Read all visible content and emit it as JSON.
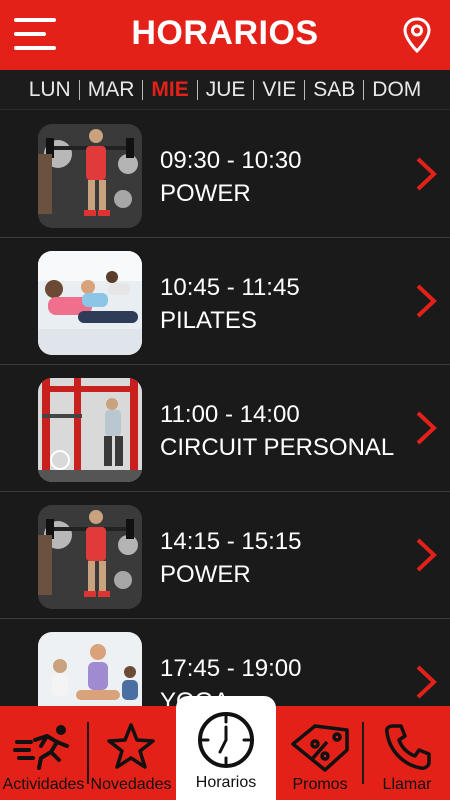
{
  "header": {
    "title": "HORARIOS",
    "menu_icon": "hamburger-menu-icon",
    "location_icon": "map-pin-icon"
  },
  "days": {
    "items": [
      "LUN",
      "MAR",
      "MIE",
      "JUE",
      "VIE",
      "SAB",
      "DOM"
    ],
    "selected": "MIE"
  },
  "schedule": [
    {
      "time": "09:30 - 10:30",
      "class": "POWER",
      "thumb": "power"
    },
    {
      "time": "10:45 - 11:45",
      "class": "PILATES",
      "thumb": "pilates"
    },
    {
      "time": "11:00 - 14:00",
      "class": "CIRCUIT PERSONAL",
      "thumb": "circuit"
    },
    {
      "time": "14:15 - 15:15",
      "class": "POWER",
      "thumb": "power"
    },
    {
      "time": "17:45 - 19:00",
      "class": "YOGA",
      "thumb": "yoga"
    }
  ],
  "tabbar": {
    "items": [
      {
        "label": "Actividades",
        "icon": "runner-icon"
      },
      {
        "label": "Novedades",
        "icon": "star-icon"
      },
      {
        "label": "Horarios",
        "icon": "clock-icon"
      },
      {
        "label": "Promos",
        "icon": "percent-tag-icon"
      },
      {
        "label": "Llamar",
        "icon": "phone-icon"
      }
    ],
    "selected": "Horarios"
  },
  "colors": {
    "accent": "#e32119",
    "background": "#1a1a1a",
    "text": "#ffffff"
  }
}
